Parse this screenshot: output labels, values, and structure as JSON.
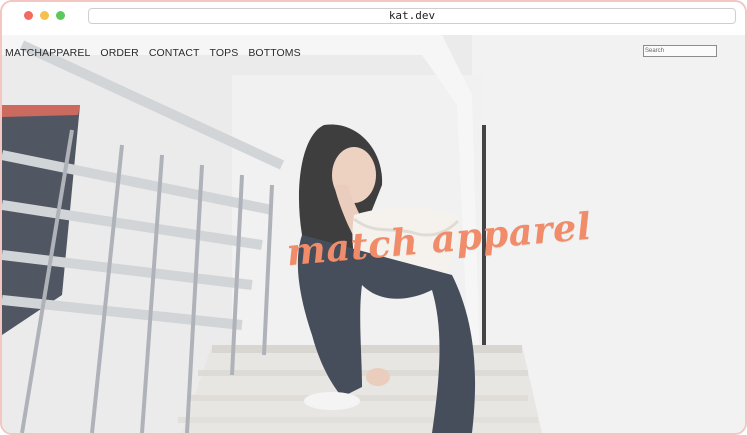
{
  "browser": {
    "url": "kat.dev"
  },
  "nav": {
    "items": [
      "MATCHAPPAREL",
      "ORDER",
      "CONTACT",
      "TOPS",
      "BOTTOMS"
    ]
  },
  "search": {
    "placeholder": "Search"
  },
  "hero": {
    "brand_text": "match apparel"
  },
  "colors": {
    "window_border": "#f3c6c2",
    "brand": "#f08c6a",
    "close": "#f26b5e",
    "minimize": "#f6c04c",
    "maximize": "#5cc95c"
  }
}
